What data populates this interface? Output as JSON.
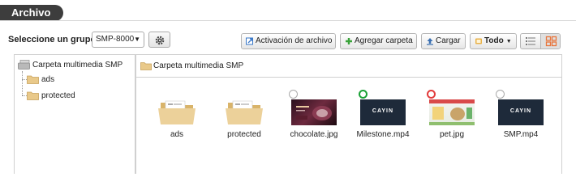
{
  "header": {
    "title": "Archivo"
  },
  "group": {
    "label": "Seleccione un grupo:",
    "selected": "SMP-8000"
  },
  "toolbar": {
    "activation_label": "Activación de archivo",
    "add_folder_label": "Agregar carpeta",
    "upload_label": "Cargar",
    "filter_label": "Todo"
  },
  "tree": {
    "root": "Carpeta multimedia SMP",
    "children": [
      "ads",
      "protected"
    ]
  },
  "content": {
    "path": "Carpeta multimedia SMP",
    "items": [
      {
        "name": "ads",
        "kind": "folder"
      },
      {
        "name": "protected",
        "kind": "folder"
      },
      {
        "name": "chocolate.jpg",
        "kind": "image",
        "status": "grey"
      },
      {
        "name": "Milestone.mp4",
        "kind": "video",
        "status": "green",
        "logo": "CAYIN"
      },
      {
        "name": "pet.jpg",
        "kind": "image",
        "status": "red"
      },
      {
        "name": "SMP.mp4",
        "kind": "video",
        "status": "grey",
        "logo": "CAYIN"
      }
    ]
  },
  "colors": {
    "header_bg": "#3d3d3d",
    "folder": "#e9c98a",
    "status_green": "#1aa135",
    "status_red": "#e23a3a",
    "accent_orange": "#e8743b"
  }
}
